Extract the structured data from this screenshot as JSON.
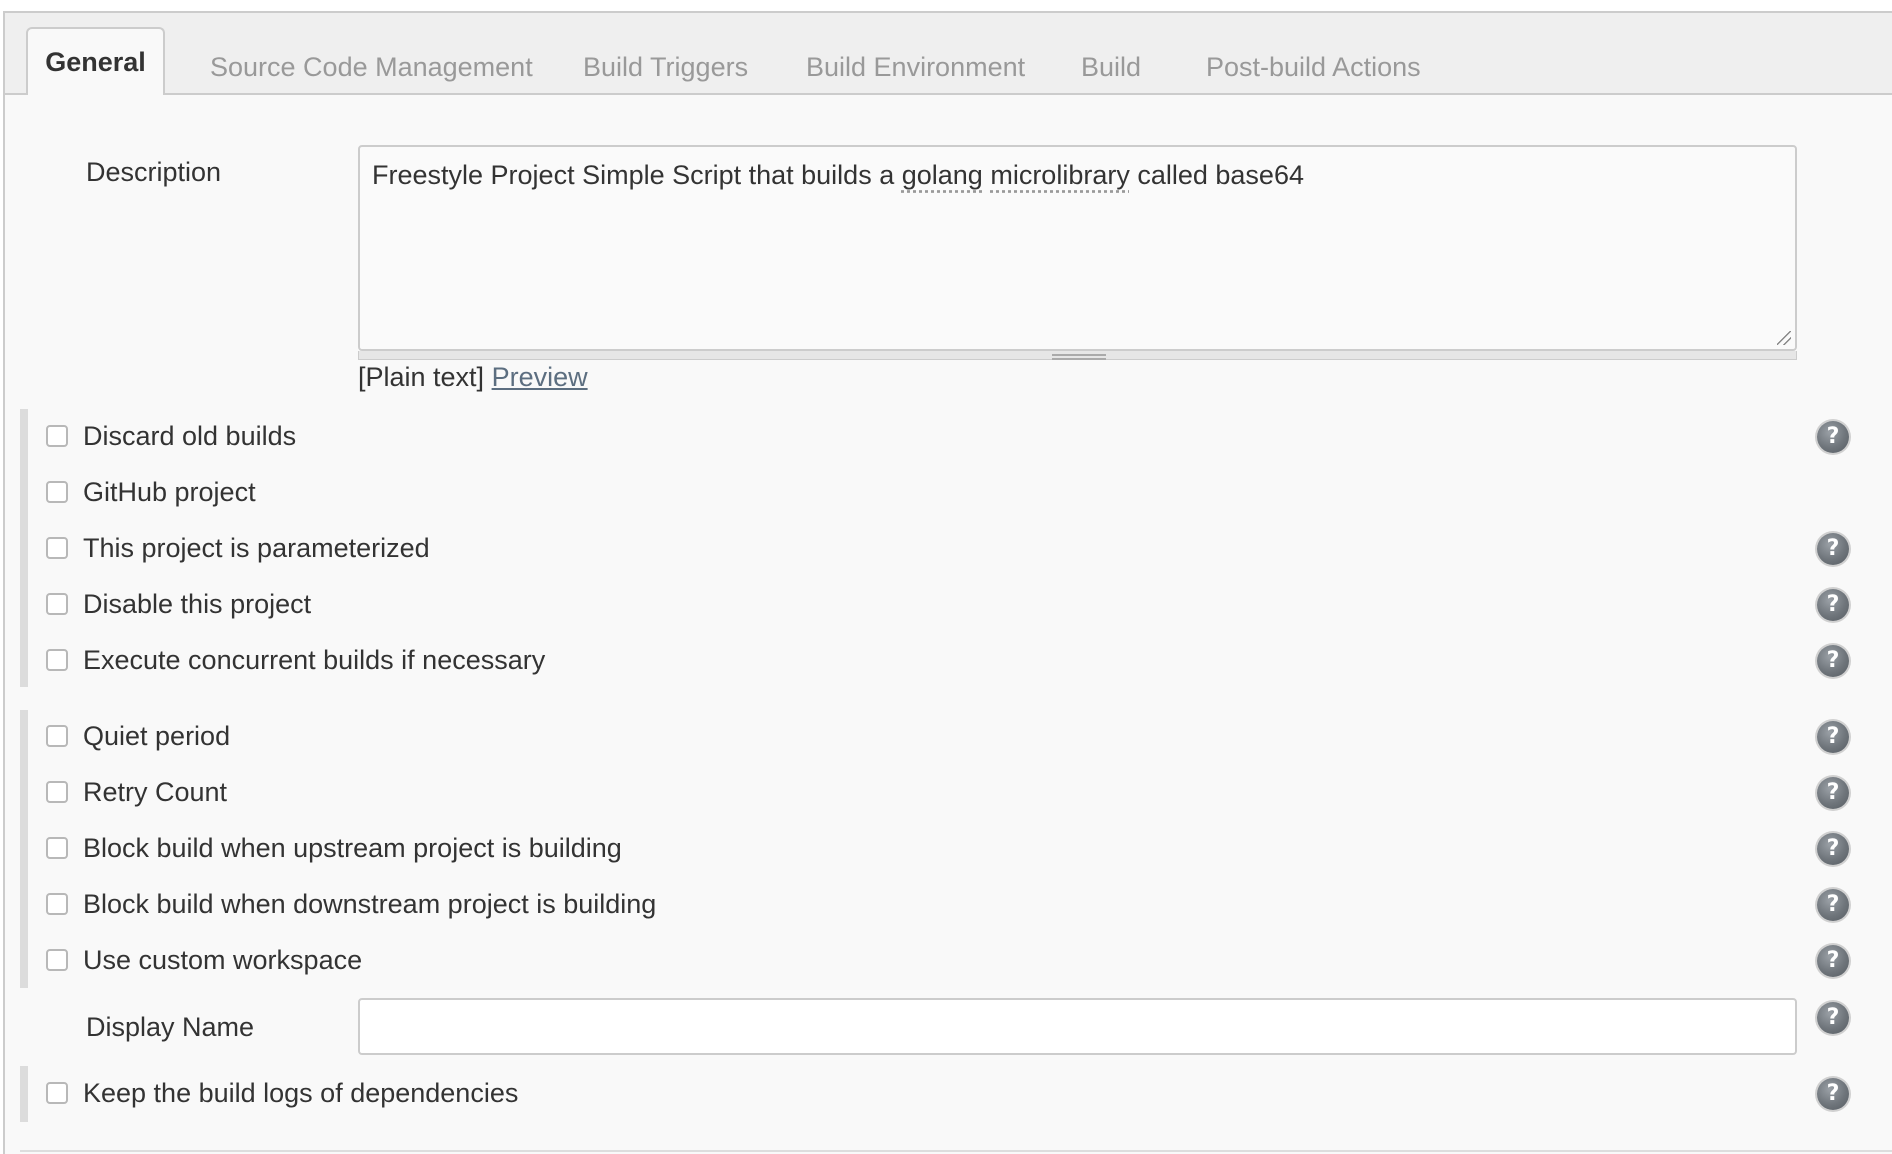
{
  "tabs": [
    {
      "label": "General",
      "active": true
    },
    {
      "label": "Source Code Management"
    },
    {
      "label": "Build Triggers"
    },
    {
      "label": "Build Environment"
    },
    {
      "label": "Build"
    },
    {
      "label": "Post-build Actions"
    }
  ],
  "description": {
    "label": "Description",
    "text_before": "Freestyle Project Simple Script that builds a ",
    "word1": "golang",
    "space": " ",
    "word2": "microlibrary",
    "text_after": " called base64",
    "markup_prefix": "[Plain text]",
    "preview_link": "Preview"
  },
  "options_group1": [
    {
      "label": "Discard old builds",
      "checked": false,
      "help": true
    },
    {
      "label": "GitHub project",
      "checked": false,
      "help": false
    },
    {
      "label": "This project is parameterized",
      "checked": false,
      "help": true
    },
    {
      "label": "Disable this project",
      "checked": false,
      "help": true
    },
    {
      "label": "Execute concurrent builds if necessary",
      "checked": false,
      "help": true
    }
  ],
  "options_group2": [
    {
      "label": "Quiet period",
      "checked": false,
      "help": true
    },
    {
      "label": "Retry Count",
      "checked": false,
      "help": true
    },
    {
      "label": "Block build when upstream project is building",
      "checked": false,
      "help": true
    },
    {
      "label": "Block build when downstream project is building",
      "checked": false,
      "help": true
    },
    {
      "label": "Use custom workspace",
      "checked": false,
      "help": true
    }
  ],
  "display_name": {
    "label": "Display Name",
    "value": ""
  },
  "options_group3": [
    {
      "label": "Keep the build logs of dependencies",
      "checked": false,
      "help": true
    }
  ],
  "help_icon_glyph": "?",
  "colors": {
    "tab_active_text": "#333333",
    "tab_inactive_text": "#999999",
    "link": "#5c6e80"
  }
}
